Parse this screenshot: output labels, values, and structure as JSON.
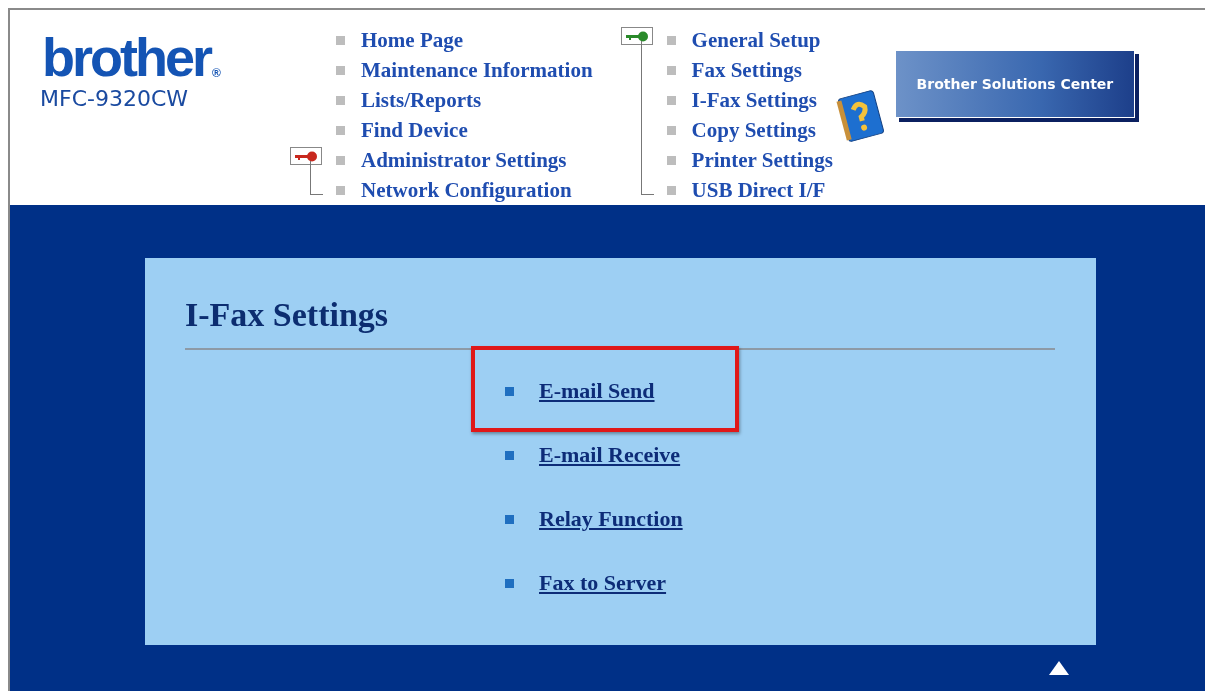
{
  "logo": {
    "brand": "brother",
    "mark": "®",
    "model": "MFC-9320CW"
  },
  "nav_columns": [
    {
      "groups": [
        {
          "items": [
            "Home Page",
            "Maintenance Information",
            "Lists/Reports",
            "Find Device"
          ]
        },
        {
          "color": "#c8281e",
          "items": [
            "Administrator Settings",
            "Network Configuration"
          ]
        }
      ]
    },
    {
      "groups": [
        {
          "color": "#2a8a2a",
          "items": [
            "General Setup",
            "Fax Settings",
            "I-Fax Settings",
            "Copy Settings",
            "Printer Settings",
            "USB Direct I/F"
          ]
        }
      ]
    }
  ],
  "solutions_banner": "Brother Solutions Center",
  "panel": {
    "title": "I-Fax Settings",
    "links": [
      {
        "label": "E-mail Send",
        "highlighted": true
      },
      {
        "label": "E-mail Receive",
        "highlighted": false
      },
      {
        "label": "Relay Function",
        "highlighted": false
      },
      {
        "label": "Fax to Server",
        "highlighted": false
      }
    ]
  }
}
